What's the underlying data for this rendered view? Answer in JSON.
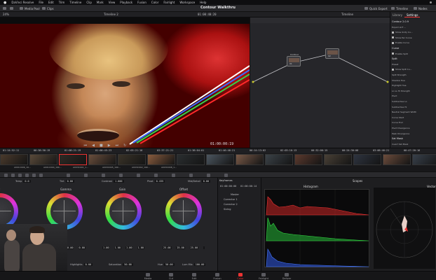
{
  "menubar": {
    "items": [
      "DaVinci Resolve",
      "File",
      "Edit",
      "Trim",
      "Timeline",
      "Clip",
      "Mark",
      "View",
      "Playback",
      "Fusion",
      "Color",
      "Fairlight",
      "Workspace",
      "Help"
    ]
  },
  "toolbar": {
    "title": "Contour Walkthru",
    "media_pool": "Media Pool",
    "clips": "Clips",
    "quick_export": "Quick Export",
    "timeline": "Timeline",
    "nodes": "Nodes"
  },
  "subheader": {
    "timeline_name": "Timeline 2",
    "source_tc": "01:00:40:20",
    "node_mode": "Timeline",
    "zoom": "24%"
  },
  "viewer": {
    "timecode": "01:00:00:19"
  },
  "nodes": [
    {
      "label": "Contour",
      "num": "01"
    },
    {
      "label": "",
      "num": "02"
    }
  ],
  "settings": {
    "tabs": [
      "Library",
      "Settings"
    ],
    "section": "Contour 2.0.9",
    "rows": [
      {
        "text": "Contour 2.0.9",
        "type": "h"
      },
      {
        "text": "Export LUT ...",
        "type": "t"
      },
      {
        "text": "Show Unity Cu...",
        "type": "c"
      },
      {
        "text": "Show Per Curve",
        "type": "c"
      },
      {
        "text": "Enable Curve",
        "type": "c"
      },
      {
        "text": "Curve",
        "type": "h"
      },
      {
        "text": "Enable Split",
        "type": "c"
      },
      {
        "text": "Split",
        "type": "h"
      },
      {
        "text": "Preset",
        "type": "t"
      },
      {
        "text": "Show Split Cu...",
        "type": "c"
      },
      {
        "text": "Split Strength",
        "type": "t"
      },
      {
        "text": "Shadow Hue",
        "type": "t"
      },
      {
        "text": "Highlight Hue",
        "type": "t"
      },
      {
        "text": "Lo vs Hi Strength",
        "type": "t"
      },
      {
        "text": "Pivot",
        "type": "t"
      },
      {
        "text": "Subtractive Lo",
        "type": "t"
      },
      {
        "text": "Subtractive Hi",
        "type": "t"
      },
      {
        "text": "Neutral Segment Width",
        "type": "t"
      },
      {
        "text": "Curve Start",
        "type": "t"
      },
      {
        "text": "Curve End",
        "type": "t"
      },
      {
        "text": "Pivot Divergence",
        "type": "t"
      },
      {
        "text": "Peak Divergence",
        "type": "t"
      },
      {
        "text": "Sat Mask",
        "type": "h"
      },
      {
        "text": "Invert Sat Mask",
        "type": "t"
      }
    ]
  },
  "timeline": {
    "timecodes": [
      "01:14:52:11",
      "00:38:56:19",
      "01:08:21:19",
      "01:00:45:23",
      "02:03:21:10",
      "03:37:21:21",
      "01:36:04:01",
      "01:46:46:21",
      "00:14:13:02",
      "02:03:16:13",
      "00:32:00:15",
      "00:24:30:08",
      "03:06:46:21",
      "00:47:20:16"
    ],
    "clip_names": [
      "A001C006_19...",
      "A001C004_190...",
      "A003C001_1...",
      "A003C005_190...",
      "A003C002_190...",
      "A003C008_1..."
    ]
  },
  "wheels": {
    "params": [
      {
        "label": "Temp",
        "value": "0.0"
      },
      {
        "label": "Tint",
        "value": "0.00"
      },
      {
        "label": "Contrast",
        "value": "1.000"
      },
      {
        "label": "Pivot",
        "value": "0.435"
      },
      {
        "label": "Mid/Detail",
        "value": "0.00"
      }
    ],
    "names": [
      "Lift",
      "Gamma",
      "Gain",
      "Offset"
    ],
    "values": [
      [
        "0.00",
        "0.00",
        "0.00",
        "0.00"
      ],
      [
        "0.00",
        "0.00",
        "0.00",
        "0.00"
      ],
      [
        "1.00",
        "1.00",
        "1.00",
        "1.00"
      ],
      [
        "25.00",
        "25.00",
        "25.00",
        ""
      ]
    ],
    "bottom_params": [
      {
        "label": "Highlights",
        "value": "0.00"
      },
      {
        "label": "Saturation",
        "value": "50.00"
      },
      {
        "label": "Hue",
        "value": "50.00"
      },
      {
        "label": "Lum Mix",
        "value": "100.00"
      }
    ]
  },
  "keyframes": {
    "title": "Keyframes",
    "tcs": [
      "01:00:00:00",
      "01:00:00:14"
    ],
    "rows": [
      "Master",
      "Corrector 1",
      "Corrector 2",
      "Sizing"
    ]
  },
  "scopes": {
    "title": "Scopes",
    "histogram": "Histogram",
    "vector": "Vector"
  },
  "pagebar": {
    "pages": [
      "Media",
      "Cut",
      "Edit",
      "Fusion",
      "Color",
      "Fairlight",
      "Deliver"
    ],
    "active": "Color"
  },
  "colors": {
    "accent": "#e33a3a",
    "panel": "#242427",
    "viewer_bg": "#0c0c0d"
  }
}
